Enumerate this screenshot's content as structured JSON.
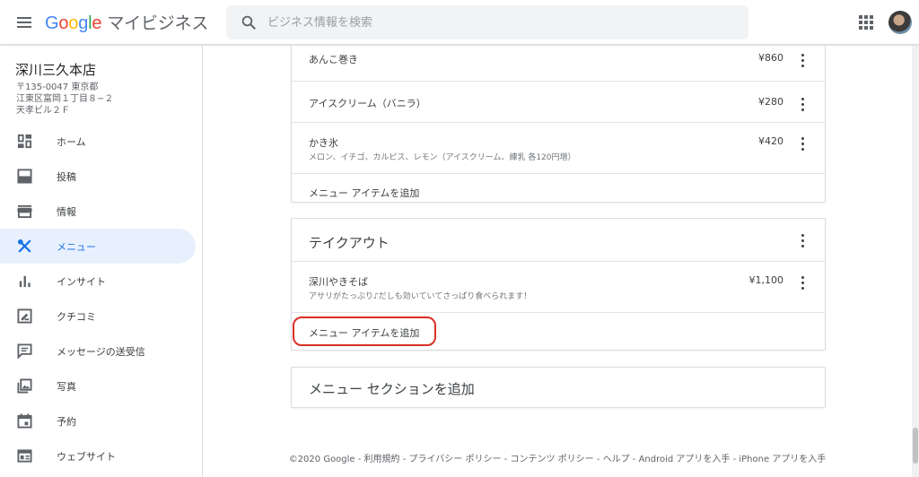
{
  "header": {
    "logo_letters": [
      "G",
      "o",
      "o",
      "g",
      "l",
      "e"
    ],
    "product": "マイビジネス",
    "search_placeholder": "ビジネス情報を検索"
  },
  "business": {
    "name": "深川三久本店",
    "address": [
      "〒135-0047 東京都",
      "江東区富岡１丁目８−２",
      "天孝ビル２Ｆ"
    ]
  },
  "sidebar": {
    "items": [
      {
        "label": "ホーム",
        "icon": "dashboard-icon"
      },
      {
        "label": "投稿",
        "icon": "posts-icon"
      },
      {
        "label": "情報",
        "icon": "storefront-icon"
      },
      {
        "label": "メニュー",
        "icon": "restaurant-icon",
        "active": true
      },
      {
        "label": "インサイト",
        "icon": "bar-chart-icon"
      },
      {
        "label": "クチコミ",
        "icon": "reviews-icon"
      },
      {
        "label": "メッセージの送受信",
        "icon": "message-icon"
      },
      {
        "label": "写真",
        "icon": "photo-icon"
      },
      {
        "label": "予約",
        "icon": "calendar-icon"
      },
      {
        "label": "ウェブサイト",
        "icon": "website-icon"
      }
    ]
  },
  "menu_card_1": {
    "items": [
      {
        "name": "あんこ巻き",
        "price": "¥860"
      },
      {
        "name": "アイスクリーム（バニラ）",
        "price": "¥280"
      },
      {
        "name": "かき氷",
        "desc": "メロン、イチゴ、カルピス、レモン（アイスクリーム、練乳 各120円増）",
        "price": "¥420"
      }
    ],
    "add_item_label": "メニュー アイテムを追加"
  },
  "menu_card_2": {
    "section_title": "テイクアウト",
    "items": [
      {
        "name": "深川やきそば",
        "desc": "アサリがたっぷり♪だしも効いていてさっぱり食べられます！",
        "price": "¥1,100"
      }
    ],
    "add_item_label": "メニュー アイテムを追加"
  },
  "add_section_label": "メニュー セクションを追加",
  "footer": "©2020 Google  -  利用規約  -  プライバシー ポリシー  -  コンテンツ ポリシー  -  ヘルプ  -  Android アプリを入手  -  iPhone アプリを入手",
  "colors": {
    "accent": "#1a73e8",
    "active_bg": "#e8f0fe",
    "highlight": "#d93025"
  }
}
